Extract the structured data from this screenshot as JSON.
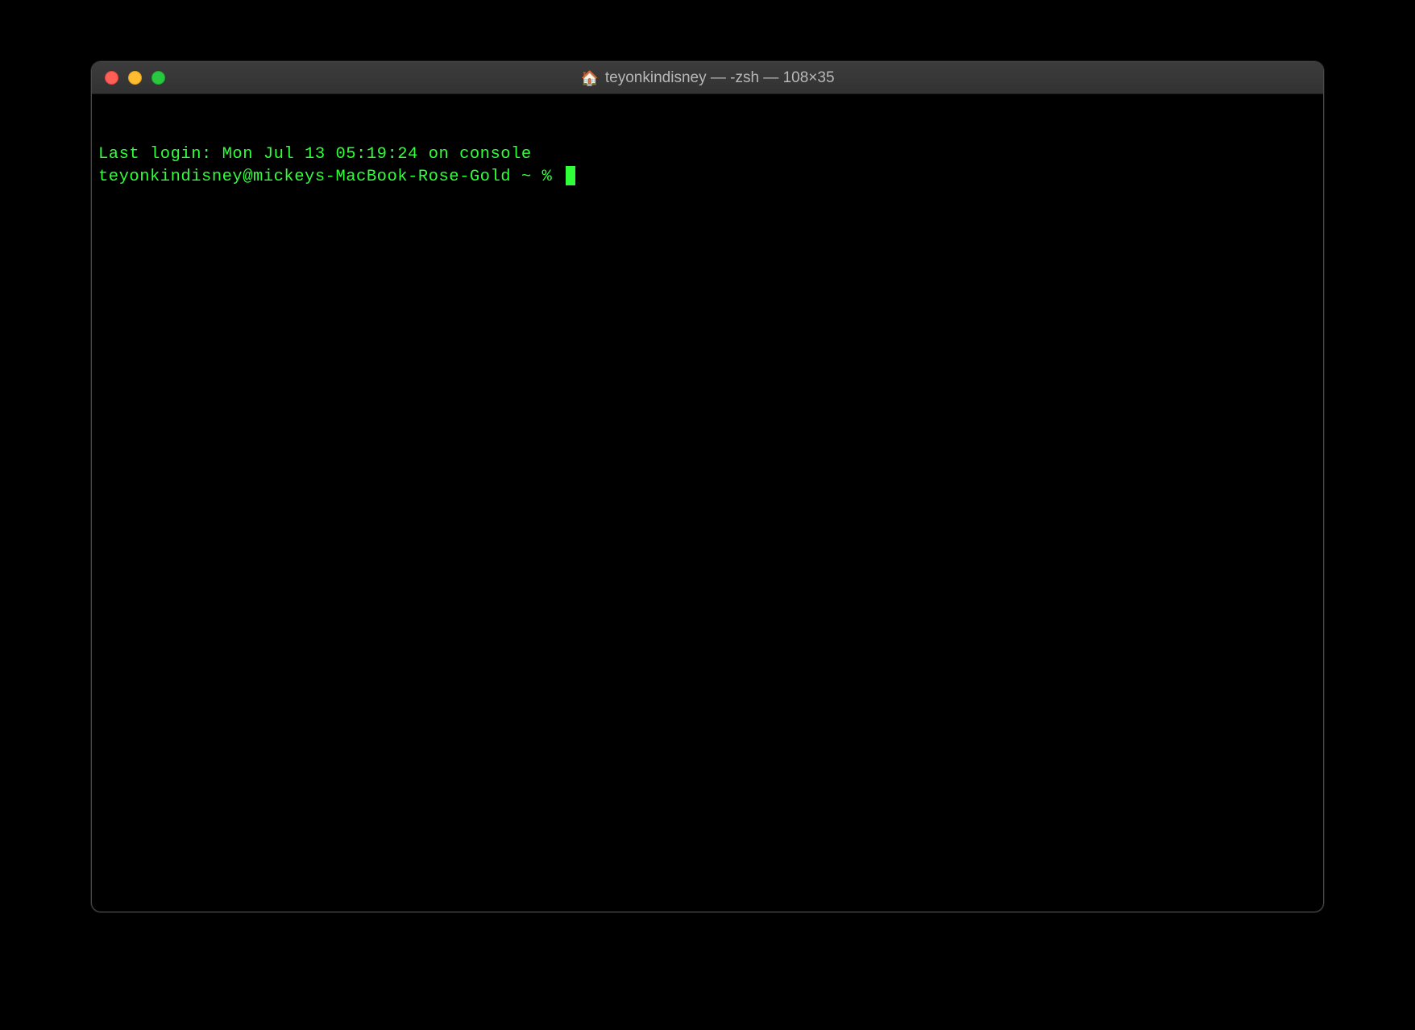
{
  "window": {
    "title_icon": "🏠",
    "title": "teyonkindisney — -zsh — 108×35"
  },
  "terminal": {
    "last_login": "Last login: Mon Jul 13 05:19:24 on console",
    "prompt": "teyonkindisney@mickeys-MacBook-Rose-Gold ~ % "
  },
  "colors": {
    "text": "#2fff38",
    "background": "#000000",
    "titlebar": "#333333",
    "close": "#ff5f57",
    "minimize": "#febc2e",
    "maximize": "#28c840"
  }
}
